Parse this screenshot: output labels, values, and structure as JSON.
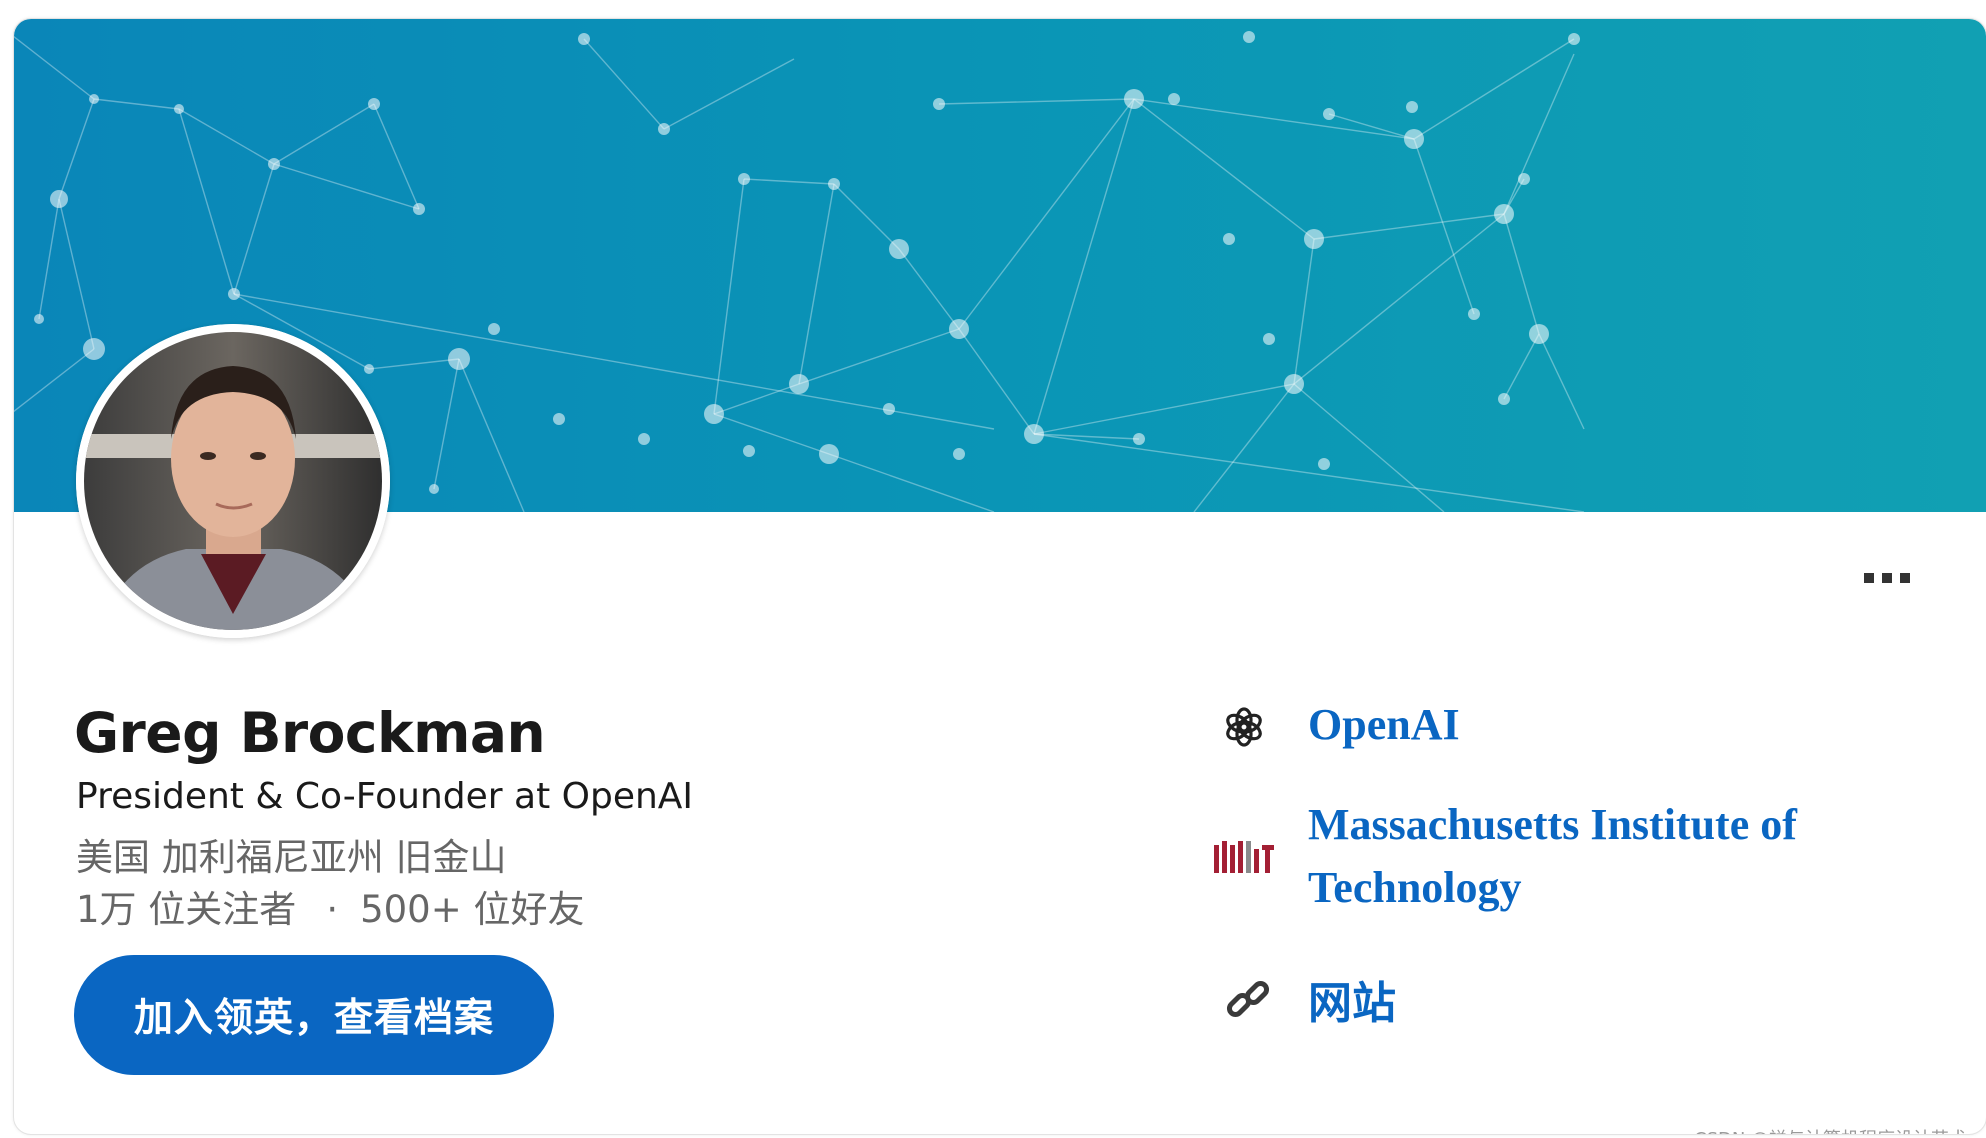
{
  "profile": {
    "name": "Greg Brockman",
    "headline": "President & Co-Founder at OpenAI",
    "location": "美国 加利福尼亚州 旧金山",
    "followers": "1万 位关注者",
    "separator": "·",
    "connections": "500+ 位好友",
    "join_button": "加入领英，查看档案"
  },
  "sidebar": {
    "company": "OpenAI",
    "school_line1": "Massachusetts Institute of",
    "school_line2": "Technology",
    "website": "网站",
    "mit_logo_text": "MIT"
  },
  "watermark": "CSDN @禅与计算机程序设计艺术",
  "colors": {
    "banner_start": "#0a86b8",
    "banner_end": "#11a0b3",
    "link": "#0a66c2",
    "button": "#0a66c2",
    "mit_red": "#a31f34"
  }
}
